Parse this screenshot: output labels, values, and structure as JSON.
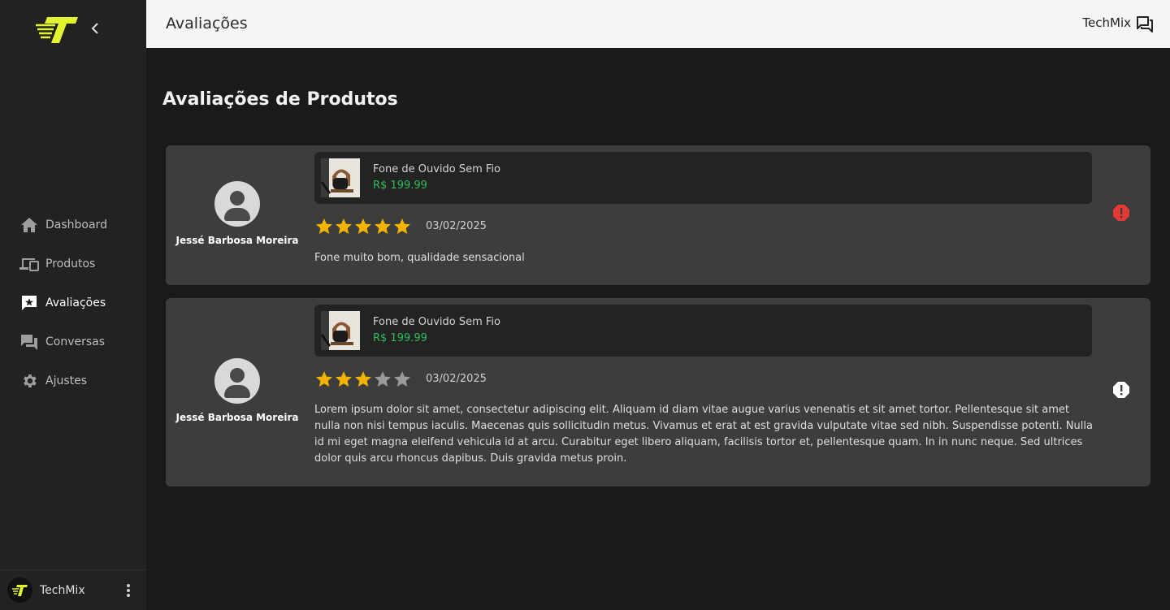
{
  "colors": {
    "accent": "#e3f42e",
    "price": "#2ebd59",
    "star_filled": "#f5b301",
    "star_empty": "#9a9a9a",
    "report_alert": "#e53935",
    "report_neutral": "#ffffff"
  },
  "sidebar": {
    "logo_icon": "brand-t-logo",
    "collapse_icon": "chevron-left-icon",
    "items": [
      {
        "label": "Dashboard",
        "icon": "home-icon",
        "active": false
      },
      {
        "label": "Produtos",
        "icon": "devices-icon",
        "active": false
      },
      {
        "label": "Avaliações",
        "icon": "review-icon",
        "active": true
      },
      {
        "label": "Conversas",
        "icon": "forum-icon",
        "active": false
      },
      {
        "label": "Ajustes",
        "icon": "gear-icon",
        "active": false
      }
    ],
    "footer": {
      "name": "TechMix",
      "menu_icon": "more-vertical-icon"
    }
  },
  "header": {
    "title": "Avaliações",
    "user": "TechMix",
    "chat_icon": "forum-icon"
  },
  "main": {
    "title": "Avaliações de Produtos",
    "reviews": [
      {
        "user_name": "Jessé Barbosa Moreira",
        "product_name": "Fone de Ouvido Sem Fio",
        "product_price": "R$ 199.99",
        "rating": 5,
        "max_rating": 5,
        "date": "03/02/2025",
        "comment": "Fone muito bom, qualidade sensacional",
        "report_state": "alert"
      },
      {
        "user_name": "Jessé Barbosa Moreira",
        "product_name": "Fone de Ouvido Sem Fio",
        "product_price": "R$ 199.99",
        "rating": 3,
        "max_rating": 5,
        "date": "03/02/2025",
        "comment": "Lorem ipsum dolor sit amet, consectetur adipiscing elit. Aliquam id diam vitae augue varius venenatis et sit amet tortor. Pellentesque sit amet nulla non nisi tempus iaculis. Maecenas quis sollicitudin metus. Vivamus et erat at est gravida vulputate vitae sed nibh. Suspendisse potenti. Nulla id mi eget magna eleifend vehicula id at arcu. Curabitur eget libero aliquam, facilisis tortor et, pellentesque quam. In in nunc neque. Sed ultrices dolor quis arcu rhoncus dapibus. Duis gravida metus proin.",
        "report_state": "neutral"
      }
    ]
  }
}
